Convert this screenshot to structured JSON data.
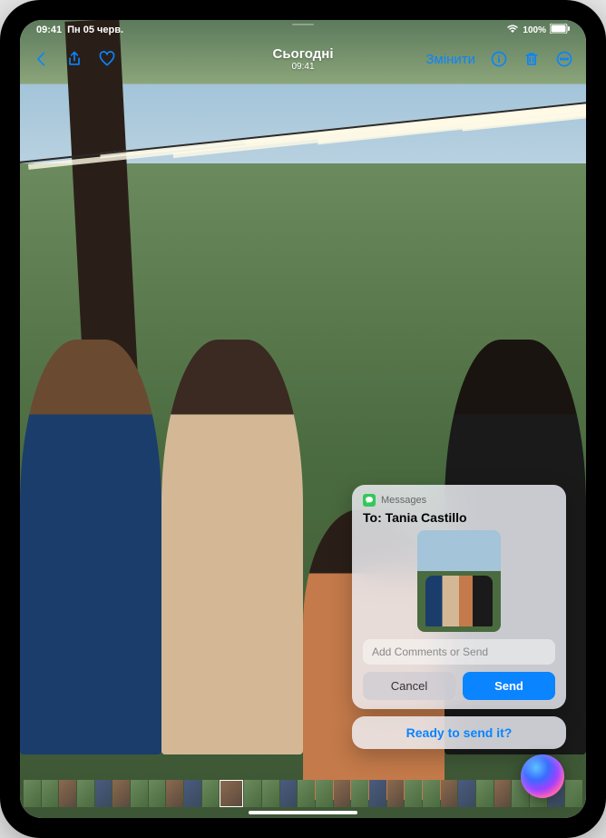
{
  "status": {
    "time": "09:41",
    "date": "Пн 05 черв.",
    "battery_pct": "100%",
    "wifi": "wifi-icon",
    "battery": "battery-icon"
  },
  "nav": {
    "title": "Сьогодні",
    "subtitle": "09:41",
    "edit_label": "Змінити"
  },
  "messages_popup": {
    "app_name": "Messages",
    "to_prefix": "To:",
    "recipient": "Tania Castillo",
    "comment_placeholder": "Add Comments or Send",
    "cancel_label": "Cancel",
    "send_label": "Send"
  },
  "siri": {
    "prompt": "Ready to send it?"
  },
  "colors": {
    "accent": "#0a84ff",
    "messages_green": "#34c759"
  }
}
